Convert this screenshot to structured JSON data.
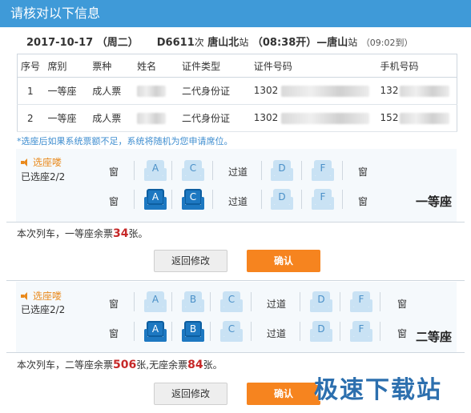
{
  "title": "请核对以下信息",
  "trip": {
    "date": "2017-10-17",
    "weekday": "（周二）",
    "train": "D6611",
    "train_suffix": "次",
    "from": "唐山北",
    "from_suffix": "站",
    "depart": "（08:38开）",
    "arrow": "—",
    "to": "唐山",
    "to_suffix": "站",
    "arrive": "（09:02到）"
  },
  "table": {
    "headers": [
      "序号",
      "席别",
      "票种",
      "姓名",
      "证件类型",
      "证件号码",
      "手机号码"
    ],
    "rows": [
      {
        "no": "1",
        "class": "一等座",
        "ticket": "成人票",
        "id_type": "二代身份证",
        "id_prefix": "1302",
        "phone_prefix": "132"
      },
      {
        "no": "2",
        "class": "一等座",
        "ticket": "成人票",
        "id_type": "二代身份证",
        "id_prefix": "1302",
        "phone_prefix": "152"
      }
    ]
  },
  "notice": "*选座后如果系统票额不足，系统将随机为您申请席位。",
  "first_class": {
    "speaker_label": "选座喽",
    "selected": "已选座2/2",
    "window": "窗",
    "aisle": "过道",
    "row1_seats": [
      "A",
      "C",
      "D",
      "F"
    ],
    "row2_seats": [
      "A",
      "C",
      "D",
      "F"
    ],
    "class_label": "一等座",
    "remain_prefix": "本次列车，一等座余票",
    "remain_count": "34",
    "remain_suffix": "张。"
  },
  "second_class": {
    "speaker_label": "选座喽",
    "selected": "已选座2/2",
    "window": "窗",
    "aisle": "过道",
    "row1_seats": [
      "A",
      "B",
      "C",
      "D",
      "F"
    ],
    "row2_seats": [
      "A",
      "B",
      "C",
      "D",
      "F"
    ],
    "class_label": "二等座",
    "remain_prefix": "本次列车，二等座余票",
    "remain_count": "506",
    "remain_mid": "张,无座余票",
    "remain_count2": "84",
    "remain_suffix": "张。"
  },
  "buttons": {
    "back": "返回修改",
    "confirm": "确认"
  },
  "watermark": "极速下载站",
  "colors": {
    "titlebar": "#3f9ad8",
    "confirm": "#f6841f",
    "seat_selected": "#1d78c1",
    "seat": "#c9e2f4",
    "count": "#c62828"
  }
}
